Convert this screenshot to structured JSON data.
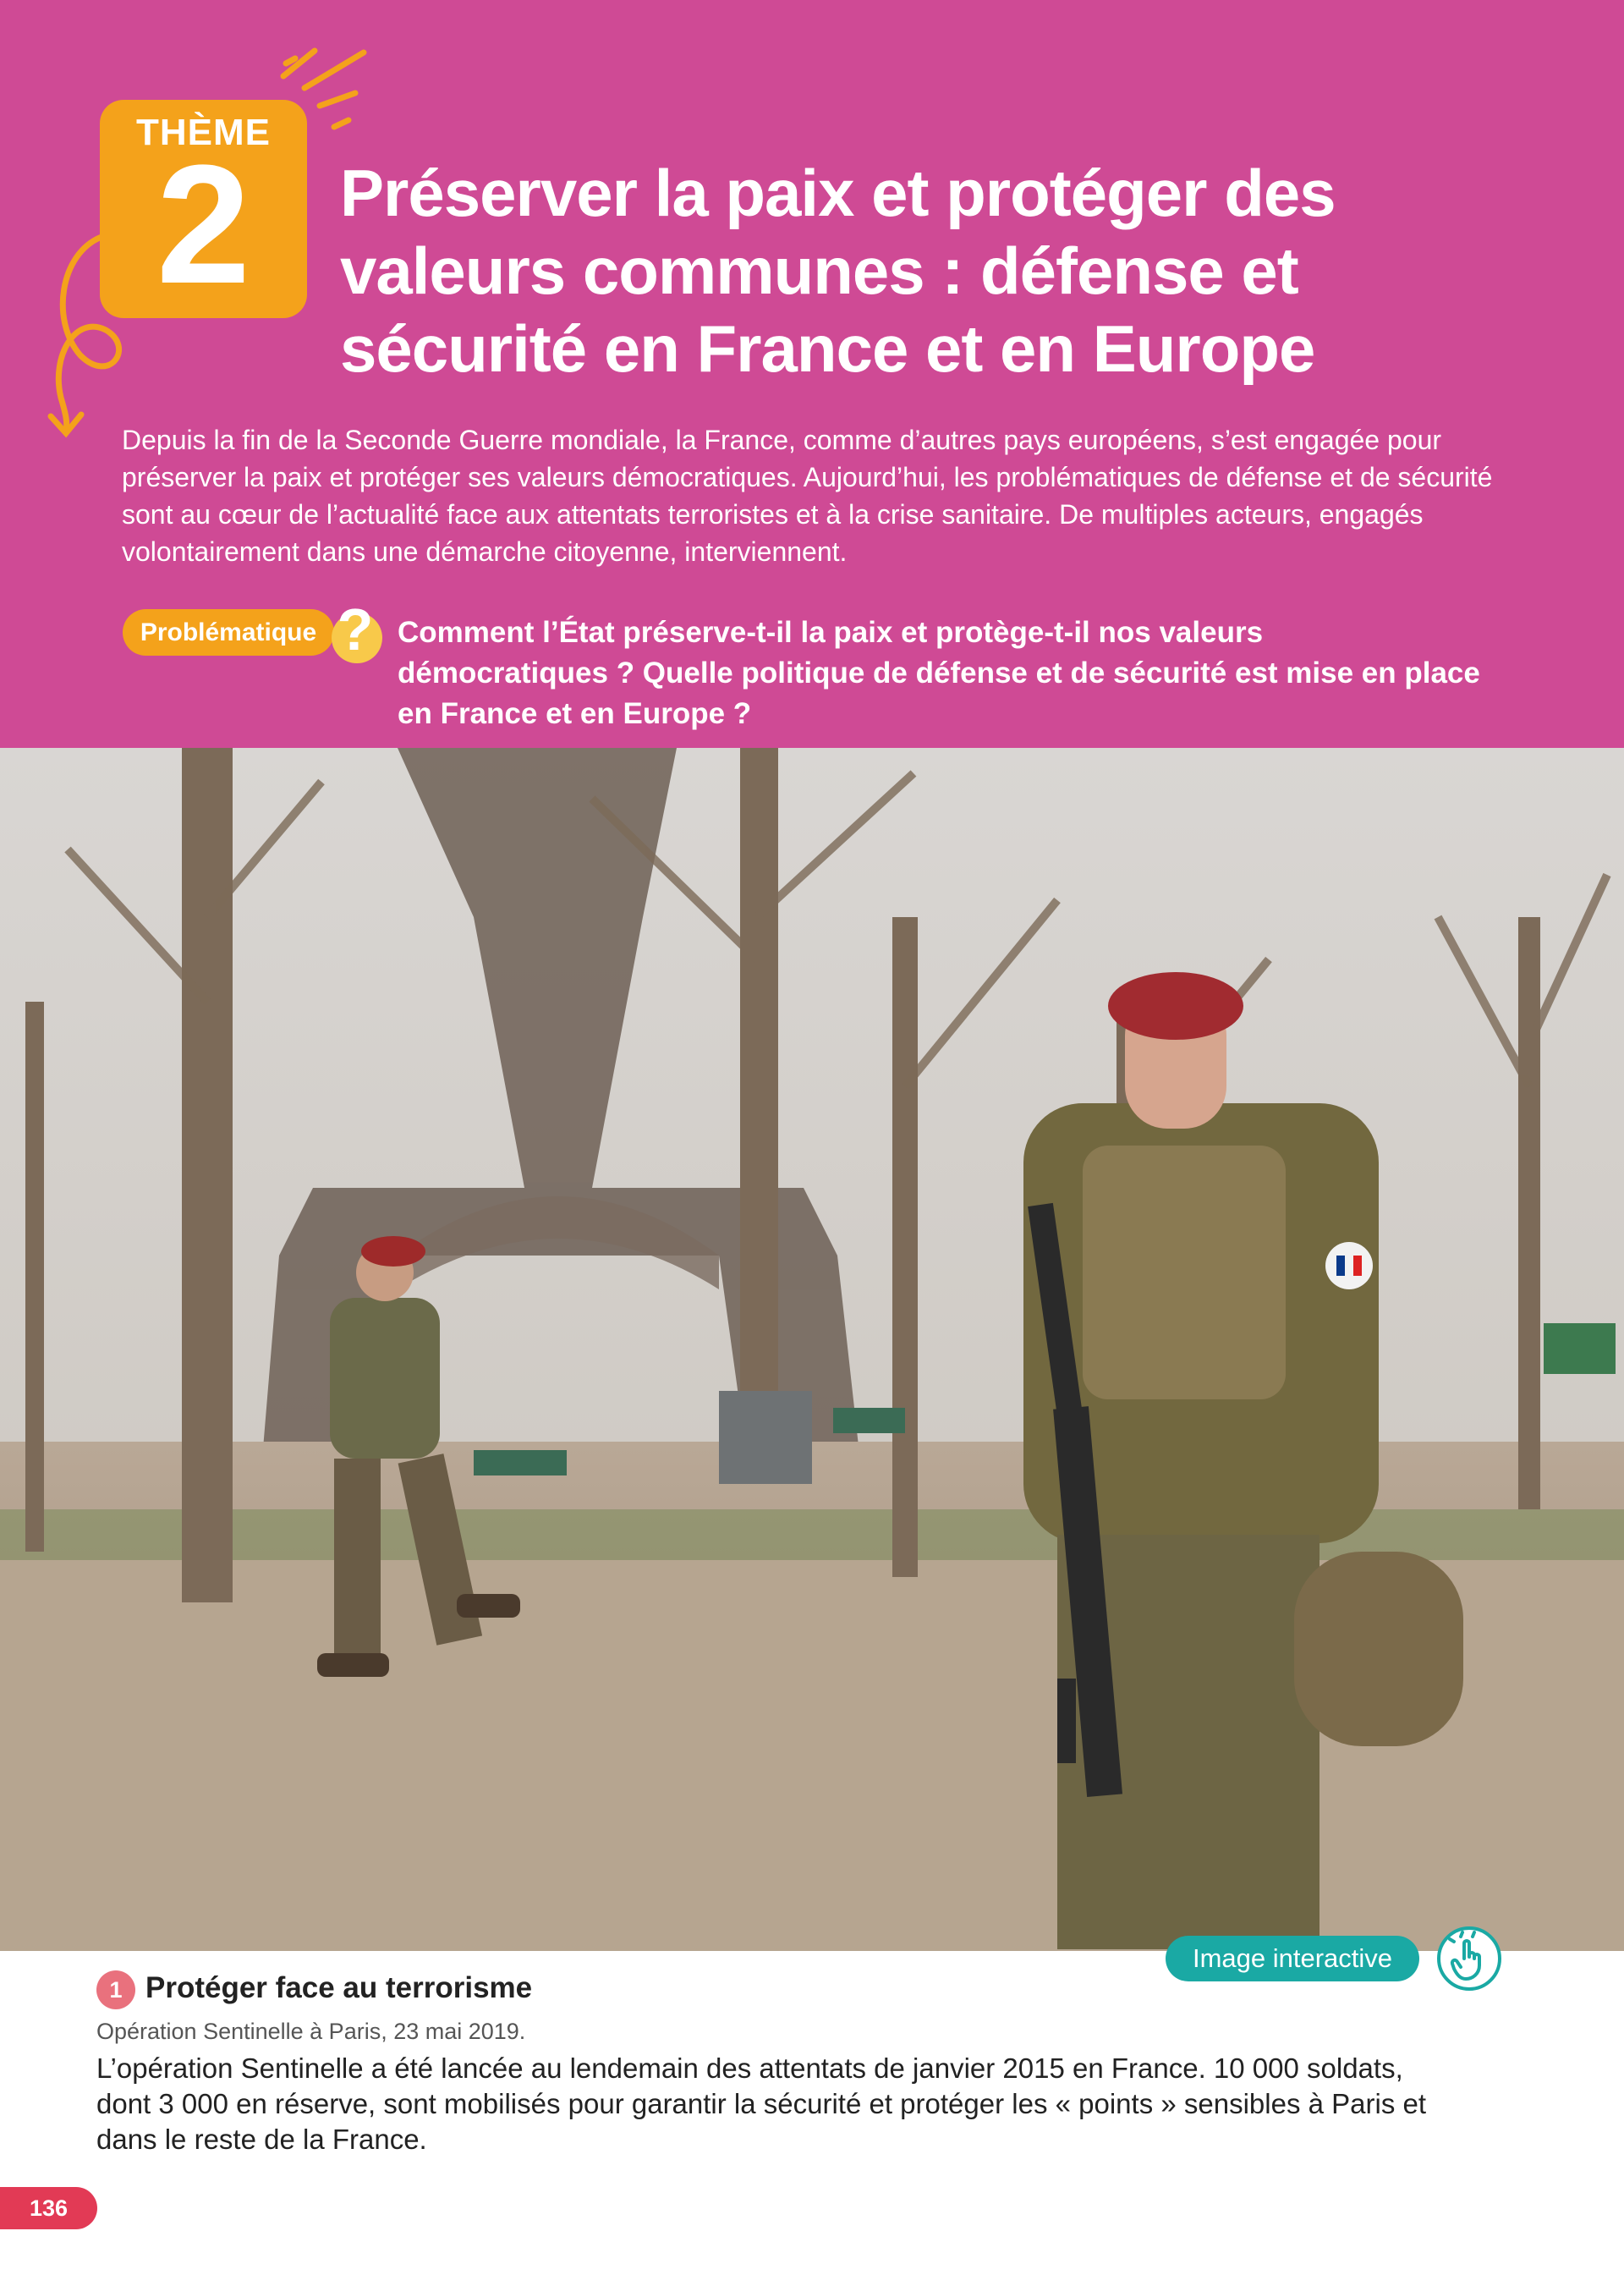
{
  "theme": {
    "label": "THÈME",
    "number": "2"
  },
  "title": "Préserver la paix et protéger des valeurs communes : défense et sécurité en France et en Europe",
  "intro": "Depuis la fin de la Seconde Guerre mondiale, la France, comme d’autres pays européens, s’est engagée pour préserver la paix et protéger ses valeurs démocratiques. Aujourd’hui, les problématiques de défense et de sécurité sont au cœur de l’actualité face aux attentats terroristes et à la crise sanitaire. De multiples acteurs, engagés volontairement dans une démarche citoyenne, interviennent.",
  "problematique": {
    "label": "Problématique",
    "question": "Comment l’État préserve-t-il la paix et protège-t-il nos valeurs démocratiques ? Quelle politique de défense et de sécurité est mise en place en France et en Europe ?"
  },
  "interactive": {
    "label": "Image interactive",
    "icon": "hand-tap-icon"
  },
  "document": {
    "number": "1",
    "title": "Protéger face au terrorisme",
    "source": "Opération Sentinelle à Paris, 23 mai 2019.",
    "text": "L’opération Sentinelle a été lancée au lendemain des attentats de janvier 2015 en France. 10 000 soldats, dont 3 000 en réserve, sont mobilisés pour garantir la sécurité et protéger les « points » sensibles à Paris et dans le reste de la France."
  },
  "page_number": "136",
  "colors": {
    "header": "#cf4a95",
    "theme_badge": "#f4a21b",
    "interactive": "#1aa9a4",
    "caption_number": "#e9717d",
    "page_number": "#e23a55"
  }
}
